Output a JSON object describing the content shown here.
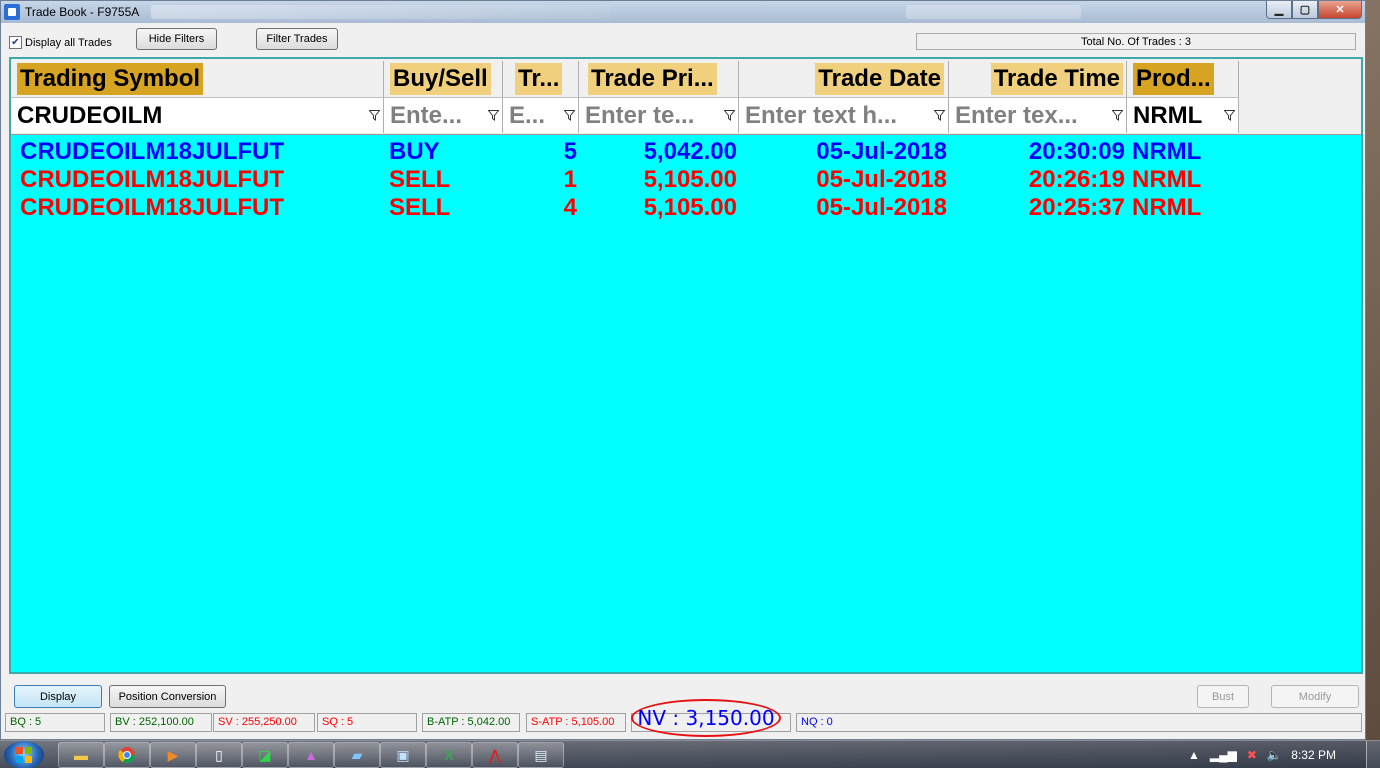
{
  "window": {
    "title": "Trade Book - F9755A",
    "controls": {
      "minimize": "▁",
      "maximize": "▢",
      "close": "✕"
    }
  },
  "toolbar": {
    "display_all_label": "Display all Trades",
    "display_all_checked": true,
    "hide_filters_label": "Hide Filters",
    "filter_trades_label": "Filter Trades",
    "total_trades": "Total No. Of Trades : 3"
  },
  "grid": {
    "columns": [
      {
        "key": "symbol",
        "label": "Trading Symbol",
        "filter": "CRUDEOILM",
        "filter_is_value": true
      },
      {
        "key": "side",
        "label": "Buy/Sell",
        "filter": "Ente...",
        "filter_is_value": false
      },
      {
        "key": "qty",
        "label": "Tr...",
        "filter": "E...",
        "filter_is_value": false
      },
      {
        "key": "price",
        "label": "Trade Pri...",
        "filter": "Enter te...",
        "filter_is_value": false
      },
      {
        "key": "date",
        "label": "Trade Date",
        "filter": "Enter text h...",
        "filter_is_value": false
      },
      {
        "key": "time",
        "label": "Trade Time",
        "filter": "Enter tex...",
        "filter_is_value": false
      },
      {
        "key": "product",
        "label": "Prod...",
        "filter": "NRML",
        "filter_is_value": true
      }
    ],
    "rows": [
      {
        "symbol": "CRUDEOILM18JULFUT",
        "side": "BUY",
        "qty": "5",
        "price": "5,042.00",
        "date": "05-Jul-2018",
        "time": "20:30:09",
        "product": "NRML"
      },
      {
        "symbol": "CRUDEOILM18JULFUT",
        "side": "SELL",
        "qty": "1",
        "price": "5,105.00",
        "date": "05-Jul-2018",
        "time": "20:26:19",
        "product": "NRML"
      },
      {
        "symbol": "CRUDEOILM18JULFUT",
        "side": "SELL",
        "qty": "4",
        "price": "5,105.00",
        "date": "05-Jul-2018",
        "time": "20:25:37",
        "product": "NRML"
      }
    ]
  },
  "actions": {
    "display_label": "Display",
    "position_conversion_label": "Position Conversion",
    "bust_label": "Bust",
    "modify_label": "Modify"
  },
  "status": {
    "bq": "BQ : 5",
    "bv": "BV : 252,100.00",
    "sv": "SV : 255,250.00",
    "sq": "SQ : 5",
    "batp": "B-ATP : 5,042.00",
    "satp": "S-ATP : 5,105.00",
    "nv": "NV : 3,150.00",
    "nq": "NQ : 0"
  },
  "taskbar": {
    "clock": "8:32 PM"
  },
  "colors": {
    "grid_background": "#00ffff",
    "buy_color": "#0000ff",
    "sell_color": "#ff0000",
    "header_label": "#f0d07c",
    "header_label_sorted": "#d6a322",
    "nv_highlight": "#e81010"
  }
}
